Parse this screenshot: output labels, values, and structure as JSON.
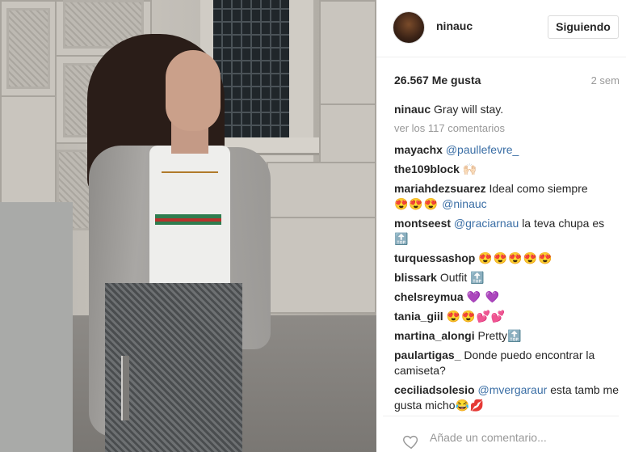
{
  "post": {
    "username": "ninauc",
    "follow_label": "Siguiendo",
    "likes": "26.567 Me gusta",
    "time_ago": "2 sem",
    "caption_user": "ninauc",
    "caption_text": "Gray will stay.",
    "view_all": "ver los 117 comentarios"
  },
  "comments": [
    {
      "user": "mayachx",
      "text": "",
      "mention": "@paullefevre_",
      "emoji": ""
    },
    {
      "user": "the109block",
      "text": "",
      "mention": "",
      "emoji": "🙌🏻"
    },
    {
      "user": "mariahdezsuarez",
      "text": "Ideal como siempre",
      "mention": "@ninauc",
      "emoji": "😍😍😍"
    },
    {
      "user": "montseest",
      "text": "la teva chupa es",
      "mention": "@graciarnau",
      "emoji": "🔝"
    },
    {
      "user": "turquessashop",
      "text": "",
      "mention": "",
      "emoji": "😍😍😍😍😍"
    },
    {
      "user": "blissark",
      "text": "Outfit",
      "mention": "",
      "emoji": "🔝"
    },
    {
      "user": "chelsreymua",
      "text": "",
      "mention": "",
      "emoji": "💜 💜"
    },
    {
      "user": "tania_giil",
      "text": "",
      "mention": "",
      "emoji": "😍😍💕💕"
    },
    {
      "user": "martina_alongi",
      "text": "Pretty",
      "mention": "",
      "emoji": "🔝"
    },
    {
      "user": "paulartigas_",
      "text": "Donde puedo encontrar la camiseta?",
      "mention": "",
      "emoji": ""
    },
    {
      "user": "ceciliadsolesio",
      "text": "esta tamb me gusta micho",
      "mention": "@mvergaraur",
      "emoji": "😂💋"
    }
  ],
  "footer": {
    "comment_placeholder": "Añade un comentario...",
    "like_icon": "heart-outline-icon"
  },
  "colors": {
    "text": "#262626",
    "muted": "#999999",
    "mention": "#3a6ea5",
    "border": "#efefef"
  }
}
